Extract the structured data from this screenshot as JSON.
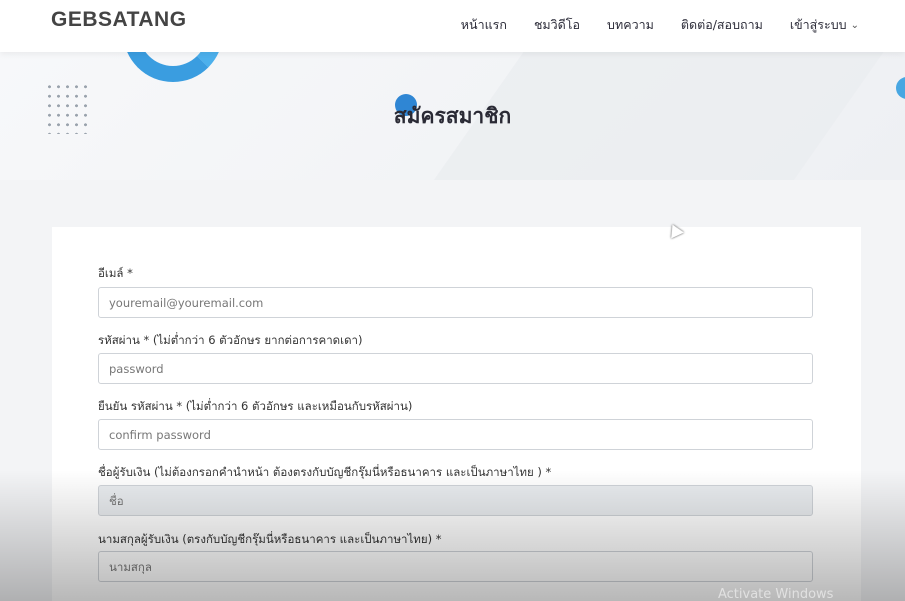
{
  "header": {
    "brand": "GEBSATANG",
    "nav": [
      {
        "label": "หน้าแรก"
      },
      {
        "label": "ชมวิดีโอ"
      },
      {
        "label": "บทความ"
      },
      {
        "label": "ติดต่อ/สอบถาม"
      },
      {
        "label": "เข้าสู่ระบบ"
      }
    ]
  },
  "hero": {
    "title": "สมัครสมาชิก"
  },
  "form": {
    "email": {
      "label": "อีเมล์ *",
      "placeholder": "youremail@youremail.com"
    },
    "password": {
      "label": "รหัสผ่าน * (ไม่ต่ำกว่า 6 ตัวอักษร ยากต่อการคาดเดา)",
      "placeholder": "password"
    },
    "confirm": {
      "label": "ยืนยัน รหัสผ่าน * (ไม่ต่ำกว่า 6 ตัวอักษร และเหมือนกับรหัสผ่าน)",
      "placeholder": "confirm password"
    },
    "first_name": {
      "label": "ชื่อผู้รับเงิน (ไม่ต้องกรอกคำนำหน้า ต้องตรงกับบัญชีกรุ๊มนี่หรือธนาคาร และเป็นภาษาไทย ) *",
      "value": "ชื่อ"
    },
    "last_name": {
      "label": "นามสกุลผู้รับเงิน (ตรงกับบัญชีกรุ๊มนี่หรือธนาคาร และเป็นภาษาไทย) *",
      "value": "นามสกุล"
    }
  },
  "watermark": "Activate Windows"
}
